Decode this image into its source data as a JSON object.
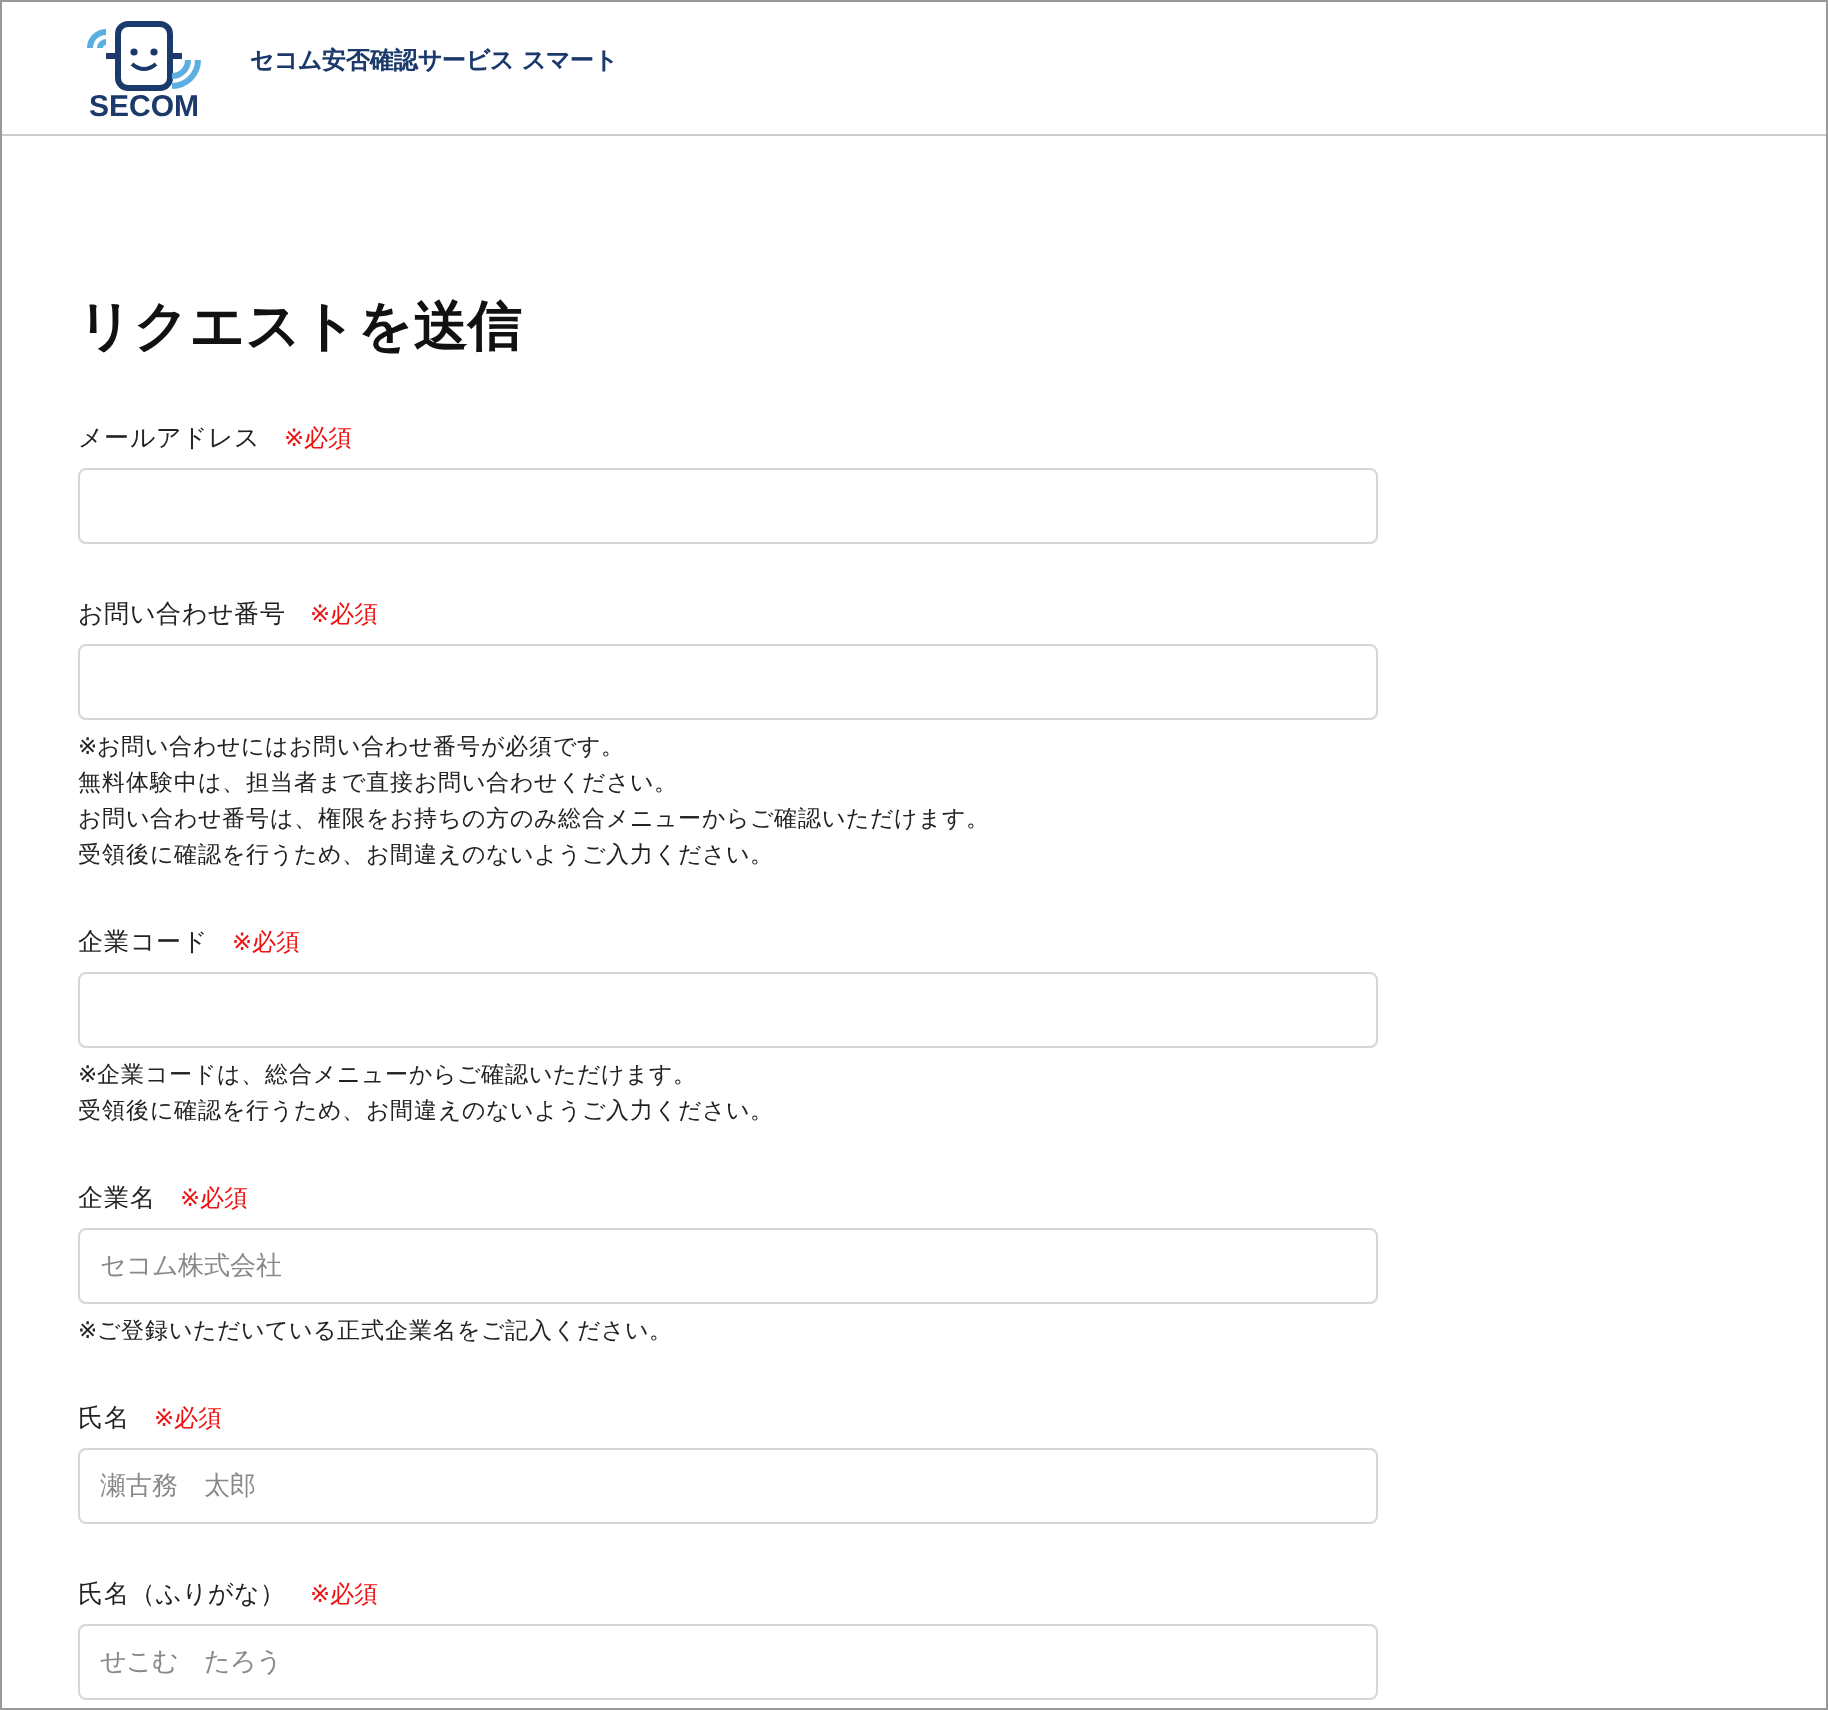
{
  "header": {
    "logo_text": "SECOM",
    "service_name": "セコム安否確認サービス スマート"
  },
  "title": "リクエストを送信",
  "fields": [
    {
      "label": "メールアドレス",
      "required": "※必須"
    },
    {
      "label": "お問い合わせ番号",
      "required": "※必須",
      "notes": [
        "※お問い合わせにはお問い合わせ番号が必須です。",
        "無料体験中は、担当者まで直接お問い合わせください。",
        "お問い合わせ番号は、権限をお持ちの方のみ総合メニューからご確認いただけます。",
        "受領後に確認を行うため、お間違えのないようご入力ください。"
      ]
    },
    {
      "label": "企業コード",
      "required": "※必須",
      "notes": [
        "※企業コードは、総合メニューからご確認いただけます。",
        "受領後に確認を行うため、お間違えのないようご入力ください。"
      ]
    },
    {
      "label": "企業名",
      "required": "※必須",
      "placeholder": "セコム株式会社",
      "notes": [
        "※ご登録いただいている正式企業名をご記入ください。"
      ]
    },
    {
      "label": "氏名",
      "required": "※必須",
      "placeholder": "瀬古務　太郎"
    },
    {
      "label": "氏名（ふりがな）",
      "required": "※必須",
      "placeholder": "せこむ　たろう"
    }
  ]
}
